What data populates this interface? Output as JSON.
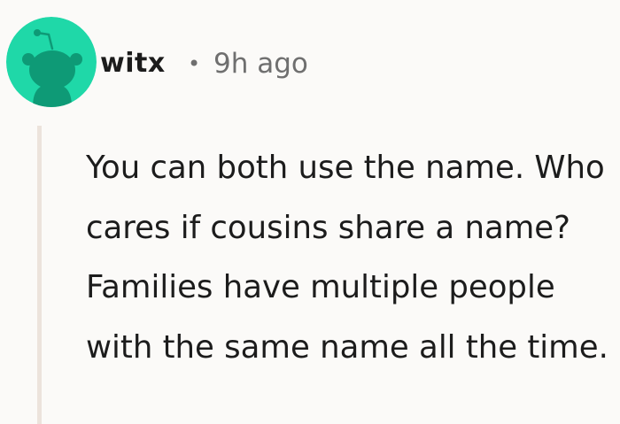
{
  "comment": {
    "author": "witx",
    "separator": "•",
    "timestamp": "9h ago",
    "body": "You can both use the name. Who cares if cousins share a name? Families have multiple people with the same name all the time."
  },
  "avatar": {
    "icon": "reddit-snoo-avatar-icon",
    "background_color": "#1fd8a8",
    "figure_color": "#0e9a76"
  }
}
